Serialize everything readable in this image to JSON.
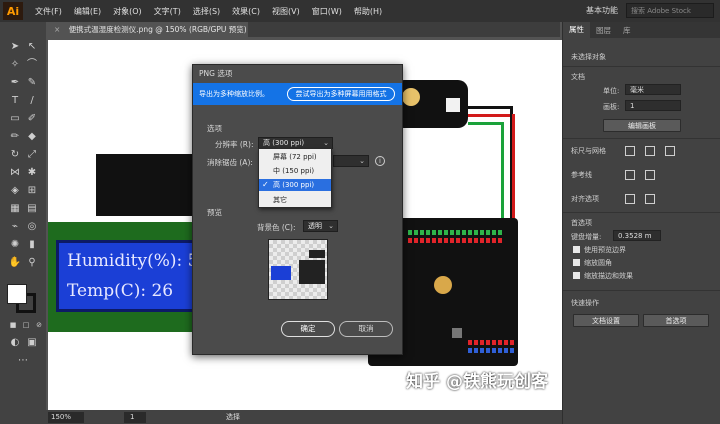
{
  "menubar": {
    "logo": "Ai",
    "items": [
      "文件(F)",
      "编辑(E)",
      "对象(O)",
      "文字(T)",
      "选择(S)",
      "效果(C)",
      "视图(V)",
      "窗口(W)",
      "帮助(H)"
    ],
    "workspace": "基本功能",
    "search_placeholder": "搜索 Adobe Stock"
  },
  "document": {
    "tab_title": "便携式温湿度检测仪.png @ 150% (RGB/GPU 预览)",
    "close_symbol": "×"
  },
  "canvas": {
    "lcd_line1": "Humidity(%): 5",
    "lcd_line2": "Temp(C): 26",
    "watermark": "知乎 @铁熊玩创客"
  },
  "statusbar": {
    "zoom": "150%",
    "page": "1",
    "status": "选择"
  },
  "right_panel": {
    "tabs": [
      "属性",
      "图层",
      "库"
    ],
    "no_selection": "未选择对象",
    "document_header": "文档",
    "units_label": "单位:",
    "units_value": "毫米",
    "artboard_label": "画板:",
    "artboard_value": "1",
    "edit_artboard_button": "编辑画板",
    "rulers_grid_header": "标尺与网格",
    "guides_header": "参考线",
    "align_header": "对齐选项",
    "preferences_header": "首选项",
    "nudge_label": "键盘增量:",
    "nudge_value": "0.3528 m",
    "check_preview_bounds": "使用预览边界",
    "check_scale_corners": "缩放圆角",
    "check_scale_strokes": "缩放描边和效果",
    "quick_actions_header": "快速操作",
    "doc_setup_button": "文档设置",
    "preferences_button": "首选项"
  },
  "dialog": {
    "title": "PNG 选项",
    "banner_text": "导出为多种缩放比例。",
    "banner_button": "尝试导出为多种屏幕用用格式",
    "options_header": "选项",
    "resolution_label": "分辨率 (R):",
    "resolution_value": "高 (300 ppi)",
    "antialias_label": "消除锯齿 (A):",
    "preview_header": "预览",
    "background_label": "背景色 (C):",
    "background_value": "透明",
    "ok_button": "确定",
    "cancel_button": "取消"
  },
  "dropdown": {
    "items": [
      "屏幕 (72 ppi)",
      "中 (150 ppi)",
      "高 (300 ppi)",
      "其它"
    ],
    "selected_index": 2,
    "check": "✓"
  },
  "colors": {
    "accent": "#1473e6",
    "lcd_blue": "#1b3fd6",
    "board_green": "#1e6b1e"
  }
}
